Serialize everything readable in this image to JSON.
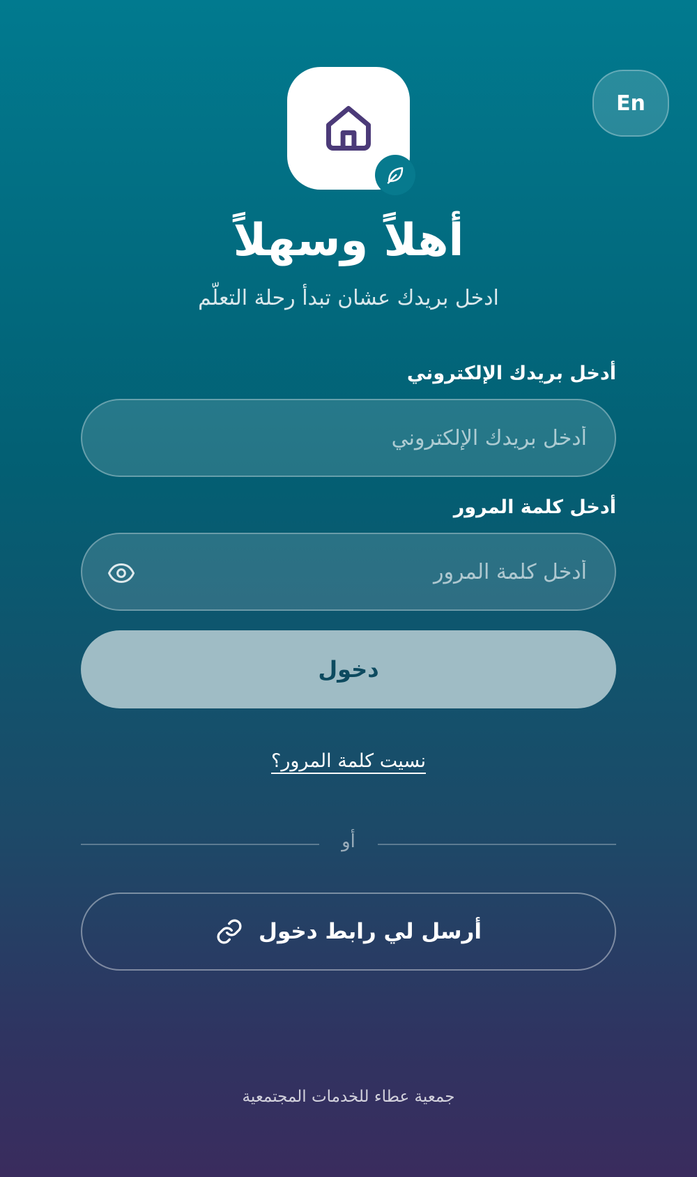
{
  "header": {
    "language_toggle_label": "En"
  },
  "brand": {
    "logo_icon": "house-icon",
    "badge_icon": "leaf-icon"
  },
  "welcome": {
    "title": "أهلاً وسهلاً",
    "subtitle": "ادخل بريدك عشان تبدأ رحلة التعلّم"
  },
  "form": {
    "email": {
      "label": "أدخل بريدك الإلكتروني",
      "placeholder": "أدخل بريدك الإلكتروني",
      "value": ""
    },
    "password": {
      "label": "أدخل كلمة المرور",
      "placeholder": "أدخل كلمة المرور",
      "value": "",
      "toggle_icon": "eye-icon"
    },
    "login_button_label": "دخول",
    "forgot_password_label": "نسيت كلمة المرور؟",
    "divider_label": "أو",
    "magic_link_button_label": "أرسل لي رابط دخول",
    "magic_link_icon": "link-icon"
  },
  "footer": {
    "organization": "جمعية عطاء للخدمات المجتمعية"
  },
  "colors": {
    "gradient_top": "#017a8f",
    "gradient_bottom": "#3a2c5e",
    "logo_icon_color": "#4b3a78",
    "login_button_bg": "#9fbcc5",
    "login_button_text": "#0d4a5f",
    "badge_bg": "#077a8e"
  }
}
